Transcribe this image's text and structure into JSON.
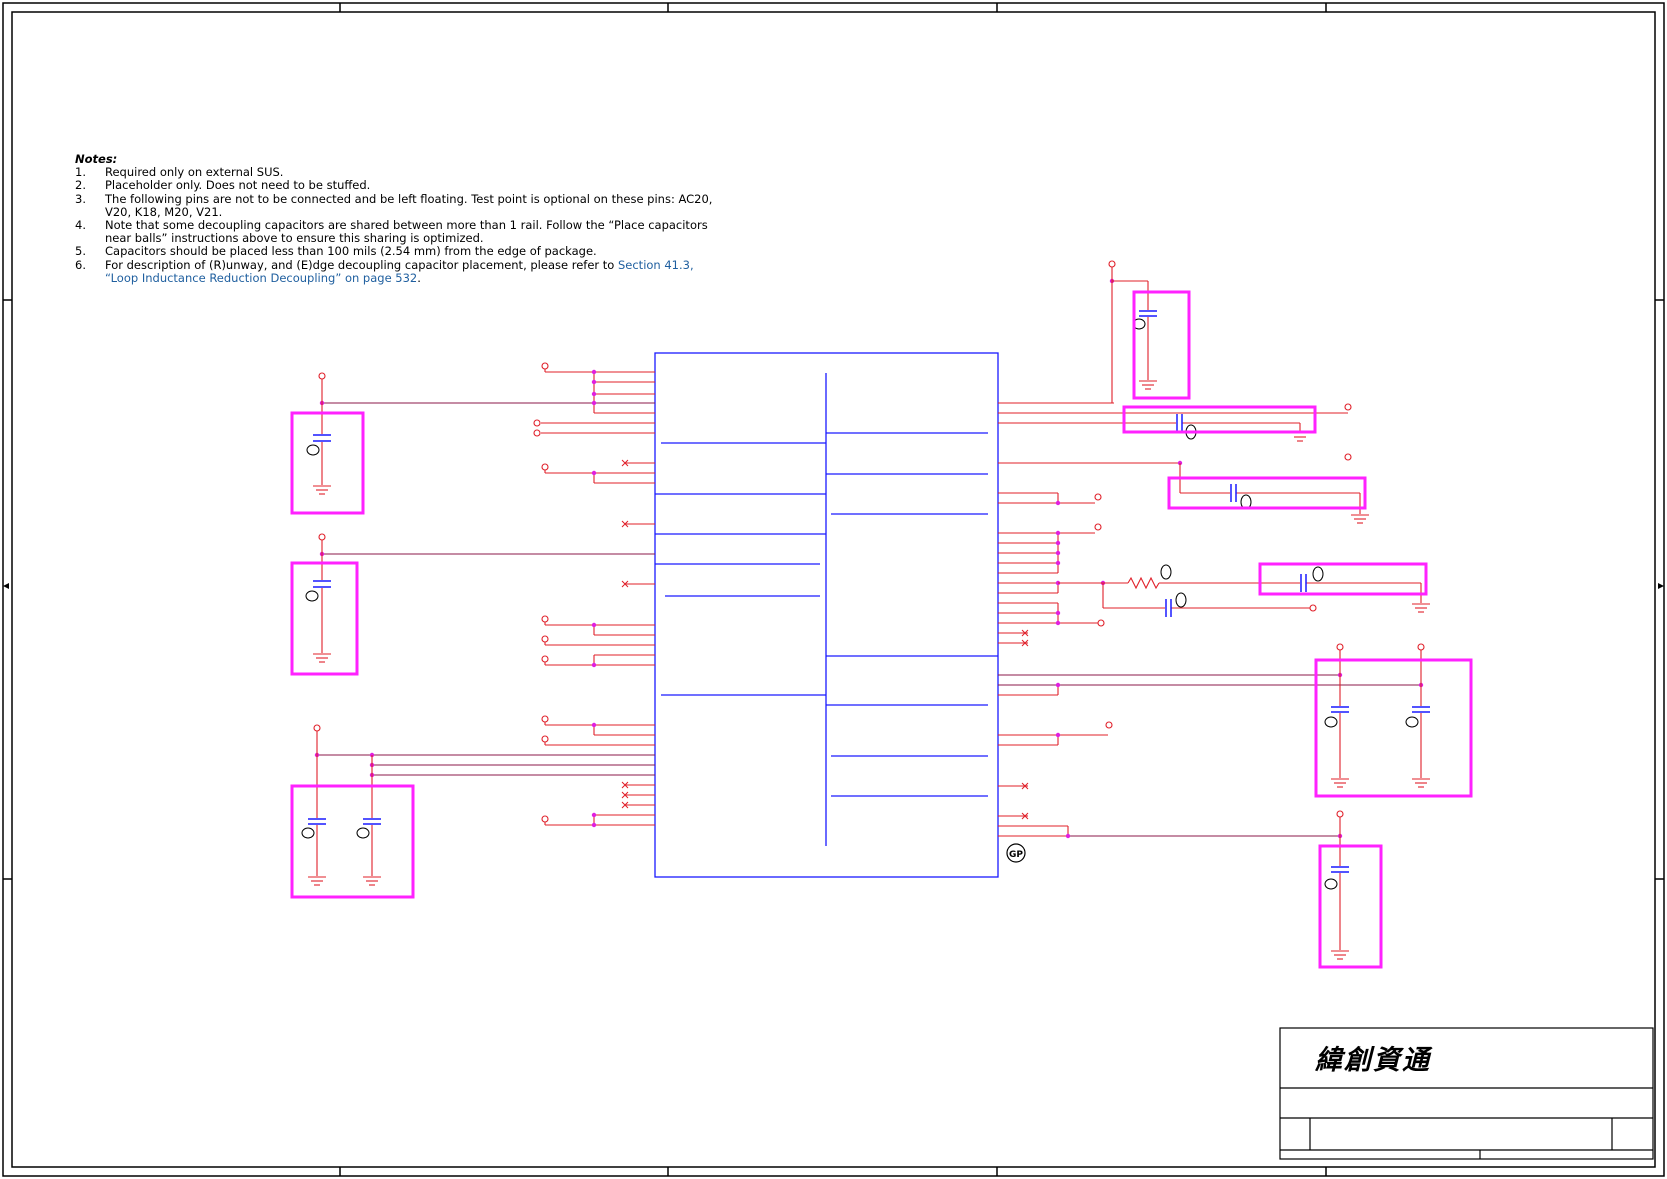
{
  "notes": {
    "heading": "Notes:",
    "items": [
      {
        "num": "1.",
        "text": "Required only on external SUS."
      },
      {
        "num": "2.",
        "text": "Placeholder only. Does not need to be stuffed."
      },
      {
        "num": "3.",
        "text": "The following pins are not to be connected and be left floating. Test point is optional on these pins: AC20,",
        "cont": "V20, K18, M20, V21."
      },
      {
        "num": "4.",
        "text": "Note that some decoupling capacitors are shared between more than 1 rail. Follow the “Place capacitors",
        "cont": "near balls” instructions above to ensure this sharing is optimized."
      },
      {
        "num": "5.",
        "text": "Capacitors should be placed less than 100 mils (2.54 mm) from the edge of package."
      },
      {
        "num": "6.",
        "text": "For description of (R)unway, and (E)dge decoupling capacitor placement, please refer to ",
        "link": "Section 41.3,",
        "cont_link": "“Loop Inductance Reduction Decoupling” on page 532",
        "cont_tail": "."
      }
    ]
  },
  "title_block": {
    "company": "緯創資通"
  },
  "symbols": {
    "gp_marker": "GP"
  },
  "colors": {
    "wire": "#e0202a",
    "net": "#8b1a4a",
    "part": "#1a1aff",
    "highlight": "#ff22ff",
    "frame": "#000000"
  }
}
